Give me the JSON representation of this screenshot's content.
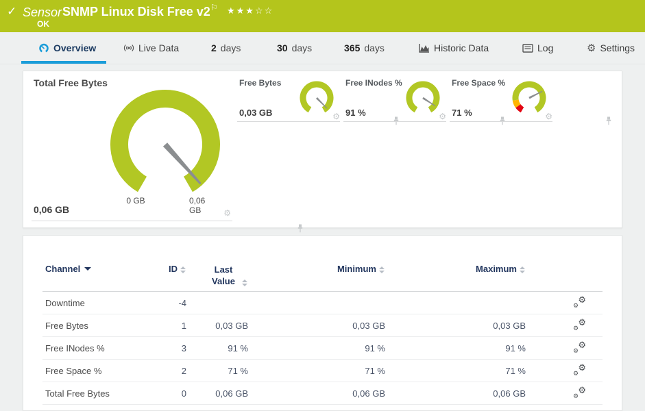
{
  "colors": {
    "banner_green": "#b4c51c",
    "gauge_green": "#b2c724",
    "gauge_red": "#e30613",
    "gauge_yellow": "#ffb400",
    "needle_gray": "#8b8e90",
    "accent_blue": "#1b9dd9",
    "header_navy": "#22365e"
  },
  "icons": {
    "check": "✓",
    "flag": "⚐",
    "gear": "⚙"
  },
  "banner": {
    "kind_label": "Sensor",
    "title": "SNMP Linux Disk Free v2",
    "status_text": "OK",
    "stars_text": "★★★☆☆"
  },
  "tabs": {
    "overview": "Overview",
    "live_data": "Live Data",
    "days2_num": "2",
    "days2_unit": "days",
    "days30_num": "30",
    "days30_unit": "days",
    "days365_num": "365",
    "days365_unit": "days",
    "historic": "Historic Data",
    "log": "Log",
    "settings": "Settings",
    "active_tab": "Overview"
  },
  "panels": {
    "gauges": {
      "primary": {
        "title": "Total Free Bytes",
        "value": "0,06 GB",
        "min_label": "0 GB",
        "max_label": "0,06 GB",
        "needle_fraction": 0.96,
        "segments": [
          {
            "from": 0,
            "to": 1,
            "color": "#b2c724"
          }
        ]
      },
      "small": [
        {
          "title": "Free Bytes",
          "value": "0,03 GB",
          "needle_fraction": 0.95,
          "segments": [
            {
              "from": 0,
              "to": 1,
              "color": "#b2c724"
            }
          ]
        },
        {
          "title": "Free INodes %",
          "value": "91 %",
          "needle_fraction": 0.91,
          "segments": [
            {
              "from": 0,
              "to": 1,
              "color": "#b2c724"
            }
          ]
        },
        {
          "title": "Free Space %",
          "value": "71 %",
          "needle_fraction": 0.71,
          "segments": [
            {
              "from": 0,
              "to": 0.08,
              "color": "#e30613"
            },
            {
              "from": 0.08,
              "to": 0.17,
              "color": "#ffb400"
            },
            {
              "from": 0.17,
              "to": 1,
              "color": "#b2c724"
            }
          ]
        }
      ]
    },
    "table": {
      "col_channel": "Channel",
      "col_id": "ID",
      "col_last": "Last Value",
      "col_min": "Minimum",
      "col_max": "Maximum",
      "sorted_by": "Channel",
      "rows": [
        {
          "channel": "Downtime",
          "id": "-4",
          "last": "",
          "min": "",
          "max": ""
        },
        {
          "channel": "Free Bytes",
          "id": "1",
          "last": "0,03 GB",
          "min": "0,03 GB",
          "max": "0,03 GB"
        },
        {
          "channel": "Free INodes %",
          "id": "3",
          "last": "91 %",
          "min": "91 %",
          "max": "91 %"
        },
        {
          "channel": "Free Space %",
          "id": "2",
          "last": "71 %",
          "min": "71 %",
          "max": "71 %"
        },
        {
          "channel": "Total Free Bytes",
          "id": "0",
          "last": "0,06 GB",
          "min": "0,06 GB",
          "max": "0,06 GB"
        }
      ]
    }
  }
}
